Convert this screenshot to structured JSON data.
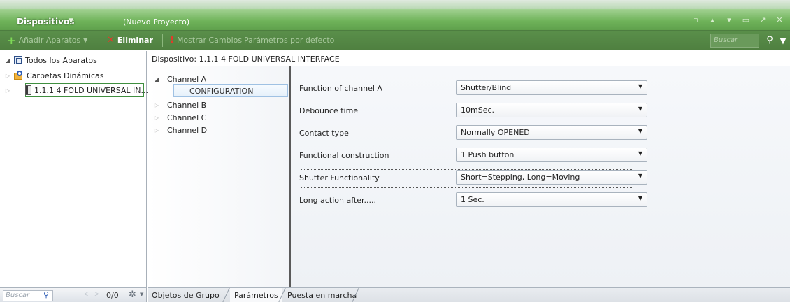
{
  "window": {
    "panel_title": "Dispositivos",
    "project_name": "(Nuevo Proyecto)"
  },
  "toolbar": {
    "add_label": "Añadir Aparatos",
    "delete_label": "Eliminar",
    "show_changes_label": "Mostrar Cambios",
    "default_params_label": "Parámetros por defecto",
    "search_placeholder": "Buscar"
  },
  "tree": {
    "items": [
      {
        "label": "Todos los Aparatos"
      },
      {
        "label": "Carpetas Dinámicas"
      },
      {
        "label": "1.1.1  4 FOLD UNIVERSAL IN..."
      }
    ]
  },
  "left_footer": {
    "search_placeholder": "Buscar",
    "count": "0/0"
  },
  "device_header": "Dispositivo: 1.1.1  4 FOLD UNIVERSAL INTERFACE",
  "channels": {
    "items": [
      {
        "label": "Channel A"
      },
      {
        "label": "Channel B"
      },
      {
        "label": "Channel C"
      },
      {
        "label": "Channel D"
      }
    ],
    "sub_item": "CONFIGURATION"
  },
  "params": [
    {
      "label": "Function of channel A",
      "value": "Shutter/Blind"
    },
    {
      "label": "Debounce time",
      "value": "10mSec."
    },
    {
      "label": "Contact type",
      "value": "Normally OPENED"
    },
    {
      "label": "Functional construction",
      "value": "1 Push button"
    },
    {
      "label": "Shutter Functionality",
      "value": "Short=Stepping, Long=Moving"
    },
    {
      "label": "Long action after.....",
      "value": "1 Sec."
    }
  ],
  "tabs": [
    {
      "label": "Objetos de Grupo"
    },
    {
      "label": "Parámetros"
    },
    {
      "label": "Puesta en marcha"
    }
  ]
}
